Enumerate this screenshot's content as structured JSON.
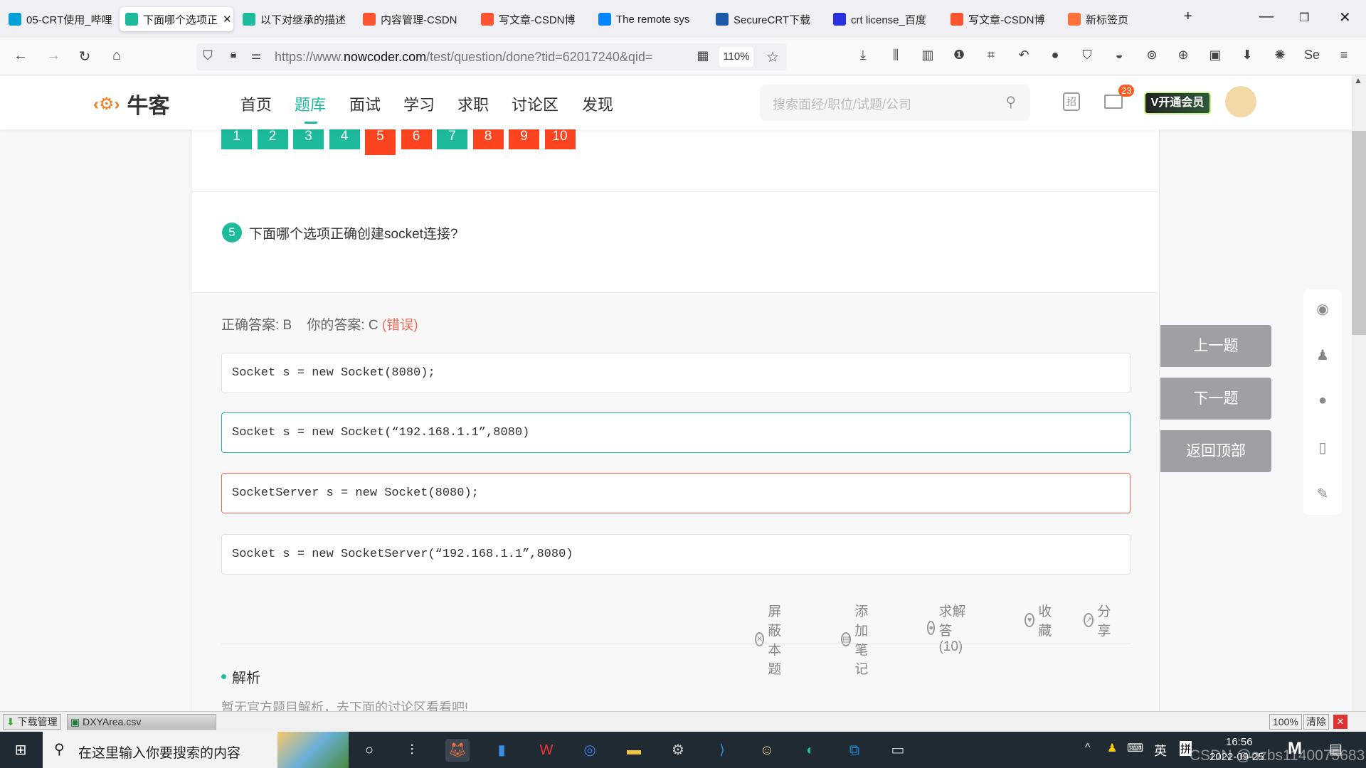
{
  "browser": {
    "tabs": [
      {
        "title": "05-CRT使用_哔哩",
        "icon": "bilibili-icon",
        "color": "#00a1d6"
      },
      {
        "title": "下面哪个选项正",
        "icon": "nowcoder-icon",
        "color": "#1dba9b",
        "active": true
      },
      {
        "title": "以下对继承的描述",
        "icon": "nowcoder-icon",
        "color": "#1dba9b"
      },
      {
        "title": "内容管理-CSDN",
        "icon": "csdn-icon",
        "color": "#fc5531"
      },
      {
        "title": "写文章-CSDN博",
        "icon": "csdn-icon",
        "color": "#fc5531"
      },
      {
        "title": "The remote sys",
        "icon": "zhihu-icon",
        "color": "#0084ff"
      },
      {
        "title": "SecureCRT下载",
        "icon": "securecrt-icon",
        "color": "#1a5aa8"
      },
      {
        "title": "crt license_百度",
        "icon": "baidu-icon",
        "color": "#2932e1"
      },
      {
        "title": "写文章-CSDN博",
        "icon": "csdn-icon",
        "color": "#fc5531"
      },
      {
        "title": "新标签页",
        "icon": "firefox-icon",
        "color": "#ff7139"
      }
    ],
    "url_prefix": "https://www.",
    "url_domain": "nowcoder.com",
    "url_rest": "/test/question/done?tid=62017240&qid=",
    "zoom": "110%"
  },
  "site": {
    "logo": "牛客",
    "nav": [
      "首页",
      "题库",
      "面试",
      "学习",
      "求职",
      "讨论区",
      "发现"
    ],
    "active_nav": "题库",
    "search_placeholder": "搜索面经/职位/试题/公司",
    "recruit_label": "招",
    "mail_badge": "23",
    "vip_label": "V开通会员"
  },
  "question_nav": [
    {
      "n": "1",
      "status": "correct"
    },
    {
      "n": "2",
      "status": "correct"
    },
    {
      "n": "3",
      "status": "correct"
    },
    {
      "n": "4",
      "status": "correct"
    },
    {
      "n": "5",
      "status": "wrong",
      "current": true
    },
    {
      "n": "6",
      "status": "wrong"
    },
    {
      "n": "7",
      "status": "correct"
    },
    {
      "n": "8",
      "status": "wrong"
    },
    {
      "n": "9",
      "status": "wrong"
    },
    {
      "n": "10",
      "status": "wrong"
    }
  ],
  "colors": {
    "correct": "#1dba9b",
    "wrong": "#fc4520"
  },
  "question": {
    "number": "5",
    "text": "下面哪个选项正确创建socket连接?",
    "correct_label": "正确答案: B",
    "your_label": "你的答案: C",
    "verdict": "(错误)",
    "options": [
      "Socket s = new Socket(8080);",
      "Socket s = new Socket(“192.168.1.1”,8080)",
      "SocketServer s = new Socket(8080);",
      "Socket s = new SocketServer(“192.168.1.1”,8080)"
    ]
  },
  "actions": [
    "屏蔽本题",
    "添加笔记",
    "求解答(10)",
    "收藏",
    "分享"
  ],
  "analysis": {
    "title": "解析",
    "text": "暂无官方题目解析，去下面的讨论区看看吧!"
  },
  "side_buttons": [
    "上一题",
    "下一题",
    "返回顶部"
  ],
  "downloads": {
    "manager": "下载管理",
    "file": "DXYArea.csv",
    "zoom": "100%",
    "clear": "清除"
  },
  "taskbar": {
    "search_placeholder": "在这里输入你要搜索的内容",
    "ime": "英",
    "pinyin": "拼",
    "time": "16:56",
    "date": "2022-09-25",
    "watermark": "CSDN @ozbs1140075683"
  }
}
